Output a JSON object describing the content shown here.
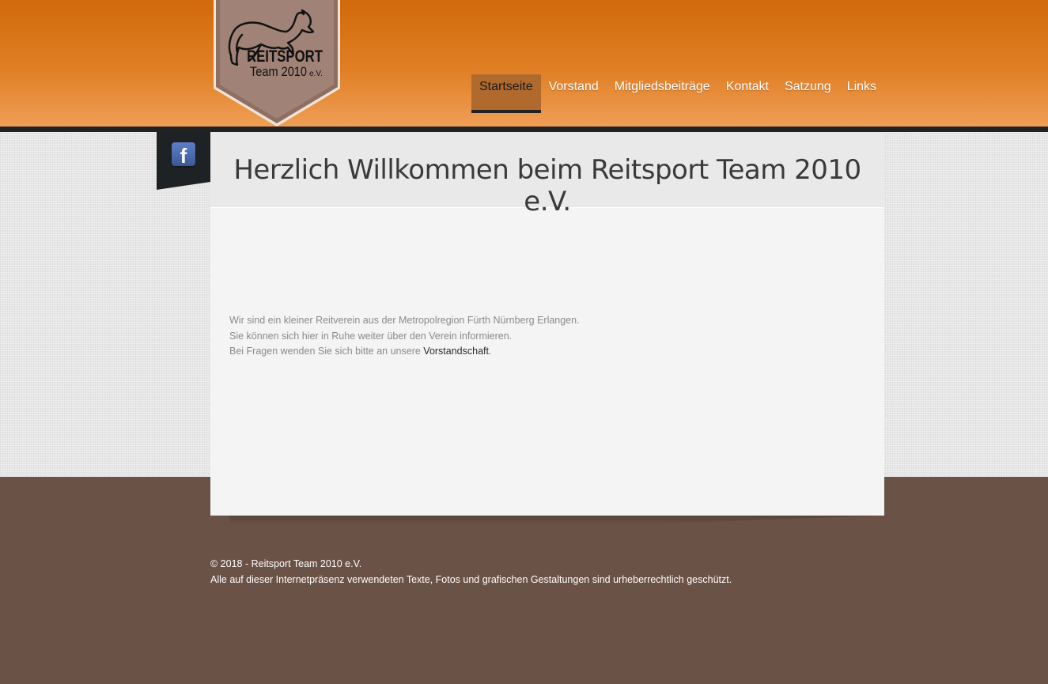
{
  "logo": {
    "line1": "REITSPORT",
    "line2": "Team 2010",
    "line3": "e.V."
  },
  "nav": [
    {
      "label": "Startseite",
      "active": true
    },
    {
      "label": "Vorstand"
    },
    {
      "label": "Mitgliedsbeiträge"
    },
    {
      "label": "Kontakt"
    },
    {
      "label": "Satzung"
    },
    {
      "label": "Links"
    }
  ],
  "social": {
    "facebook_glyph": "f"
  },
  "main": {
    "title": "Herzlich Willkommen beim Reitsport Team 2010 e.V.",
    "line1": "Wir sind ein kleiner Reitverein aus der Metropolregion Fürth Nürnberg Erlangen.",
    "line2": "Sie können sich hier in Ruhe weiter über den Verein informieren.",
    "line3_prefix": "Bei Fragen wenden Sie sich bitte an unsere ",
    "line3_link": "Vorstandschaft",
    "line3_suffix": "."
  },
  "footer": {
    "copyright": "© 2018 - Reitsport Team 2010 e.V.",
    "notice": "Alle auf dieser Internetpräsenz verwendeten Texte, Fotos und grafischen Gestaltungen sind urheberrechtlich geschützt."
  },
  "colors": {
    "header_orange": "#d06a0b",
    "nav_active": "#b06a2e",
    "footer_brown": "#6b5246",
    "facebook_blue": "#3b5998"
  }
}
